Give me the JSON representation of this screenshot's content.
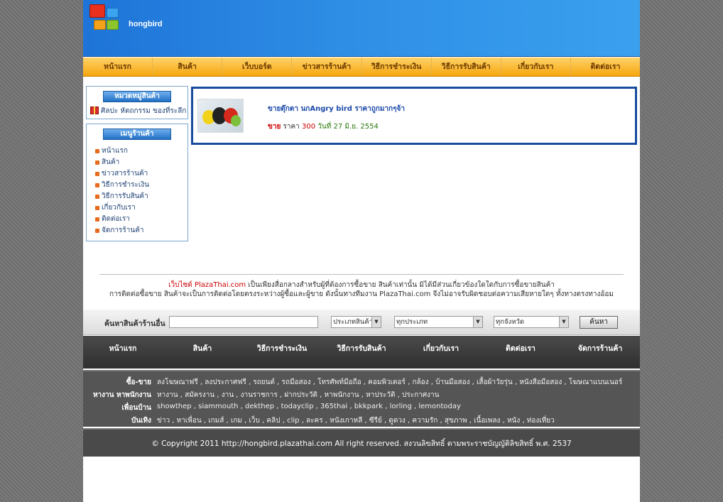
{
  "header": {
    "site_name": "hongbird"
  },
  "topnav": [
    {
      "label": "หน้าแรก"
    },
    {
      "label": "สินค้า"
    },
    {
      "label": "เว็บบอร์ด"
    },
    {
      "label": "ข่าวสารร้านค้า"
    },
    {
      "label": "วิธีการชำระเงิน"
    },
    {
      "label": "วิธีการรับสินค้า"
    },
    {
      "label": "เกี่ยวกับเรา"
    },
    {
      "label": "ติดต่อเรา"
    }
  ],
  "category_box": {
    "title": "หมวดหมู่สินค้า",
    "item": "ศิลปะ หัตถกรรม ของที่ระลึก"
  },
  "shop_menu": {
    "title": "เมนูร้านค้า",
    "items": [
      {
        "label": "หน้าแรก"
      },
      {
        "label": "สินค้า"
      },
      {
        "label": "ข่าวสารร้านค้า"
      },
      {
        "label": "วิธีการชำระเงิน"
      },
      {
        "label": "วิธีการรับสินค้า"
      },
      {
        "label": "เกี่ยวกับเรา"
      },
      {
        "label": "ติดต่อเรา"
      },
      {
        "label": "จัดการร้านค้า"
      }
    ]
  },
  "product": {
    "title": "ขายตุ๊กตา นกAngry bird ราคาถูกมากๆจ้า",
    "type": "ขาย",
    "price_label": "ราคา",
    "price": "300",
    "date": "วันที่ 27 มิ.ย. 2554"
  },
  "disclaimer": {
    "site_ref": "เว็บไซต์ PlazaThai.com",
    "line1_rest": "เป็นเพียงสื่อกลางสำหรับผู้ที่ต้องการซื้อขาย สินค้าเท่านั้น มิได้มีส่วนเกี่ยวข้องใดใดกับการซื้อขายสินค้า",
    "line2": "การติดต่อซื้อขาย สินค้าจะเป็นการติดต่อโดยตรงระหว่างผู้ซื้อและผู้ขาย ดังนั้นทางทีมงาน PlazaThai.com จึงไม่อาจรับผิดชอบต่อความเสียหายใดๆ ทั้งทางตรงทางอ้อม"
  },
  "search": {
    "label": "ค้นหาสินค้าร้านอื่น",
    "input_value": "",
    "select_type": "ประเภทสินค้า",
    "select_category": "ทุกประเภท",
    "select_province": "ทุกจังหวัด",
    "button_label": "ค้นหา"
  },
  "footnav": [
    {
      "label": "หน้าแรก"
    },
    {
      "label": "สินค้า"
    },
    {
      "label": "วิธีการชำระเงิน"
    },
    {
      "label": "วิธีการรับสินค้า"
    },
    {
      "label": "เกี่ยวกับเรา"
    },
    {
      "label": "ติดต่อเรา"
    },
    {
      "label": "จัดการร้านค้า"
    }
  ],
  "link_rows": [
    {
      "label": "ซื้อ-ขาย",
      "links": "ลงโฆษณาฟรี , ลงประกาศฟรี , รถยนต์ , รถมือสอง , โทรศัพท์มือถือ , คอมพิวเตอร์ , กล้อง , บ้านมือสอง , เสื้อผ้าวัยรุ่น , หนังสือมือสอง , โฆษณาแบนเนอร์"
    },
    {
      "label": "หางาน หาพนักงาน",
      "links": "หางาน , สมัครงาน , งาน , งานราชการ , ฝากประวัติ , หาพนักงาน , หาประวัติ , ประกาศงาน"
    },
    {
      "label": "เพื่อนบ้าน",
      "links": "showthep , siammouth , dekthep , todayclip , 365thai , bkkpark , lorling , lemontoday"
    },
    {
      "label": "บันเทิง",
      "links": "ข่าว , หาเพื่อน , เกมส์ , เกม , เว็บ , คลิป , clip , ละคร , หนังเกาหลี , ซีรีย์ , ดูดวง , ความรัก , สุขภาพ , เนื้อเพลง , หนัง , ท่องเที่ยว"
    }
  ],
  "copyright": "© Copyright 2011 http://hongbird.plazathai.com All right reserved. สงวนลิขสิทธิ์ ตามพระราชบัญญัติลิขสิทธิ์ พ.ศ. 2537"
}
